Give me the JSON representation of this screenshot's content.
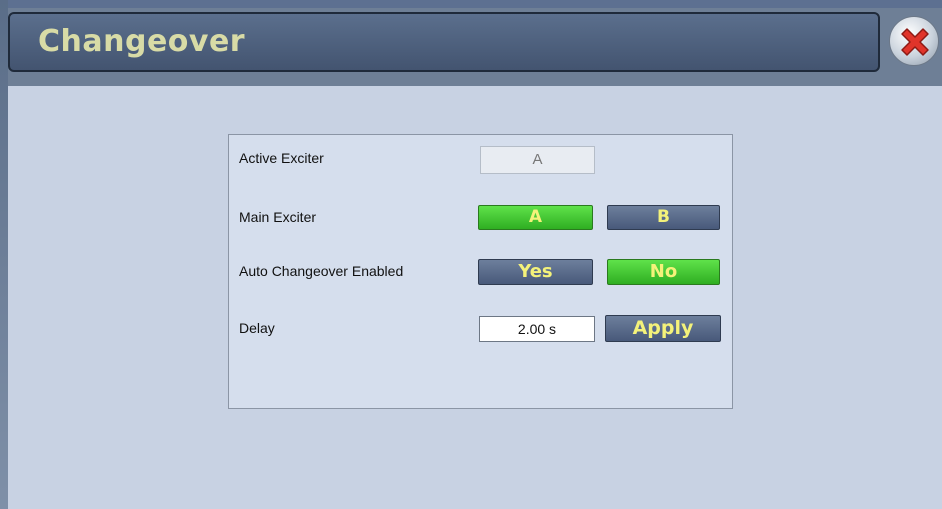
{
  "header": {
    "title": "Changeover"
  },
  "icons": {
    "close": "close-icon"
  },
  "colors": {
    "active_green": "#3fc82e",
    "inactive_gray": "#5a6b8a",
    "button_text": "#f4f27a"
  },
  "panel": {
    "active_exciter": {
      "label": "Active Exciter",
      "value": "A"
    },
    "main_exciter": {
      "label": "Main Exciter",
      "option_a": "A",
      "option_b": "B",
      "selected": "A"
    },
    "auto_changeover": {
      "label": "Auto Changeover Enabled",
      "option_yes": "Yes",
      "option_no": "No",
      "selected": "No"
    },
    "delay": {
      "label": "Delay",
      "value": "2.00 s",
      "apply_label": "Apply"
    }
  }
}
